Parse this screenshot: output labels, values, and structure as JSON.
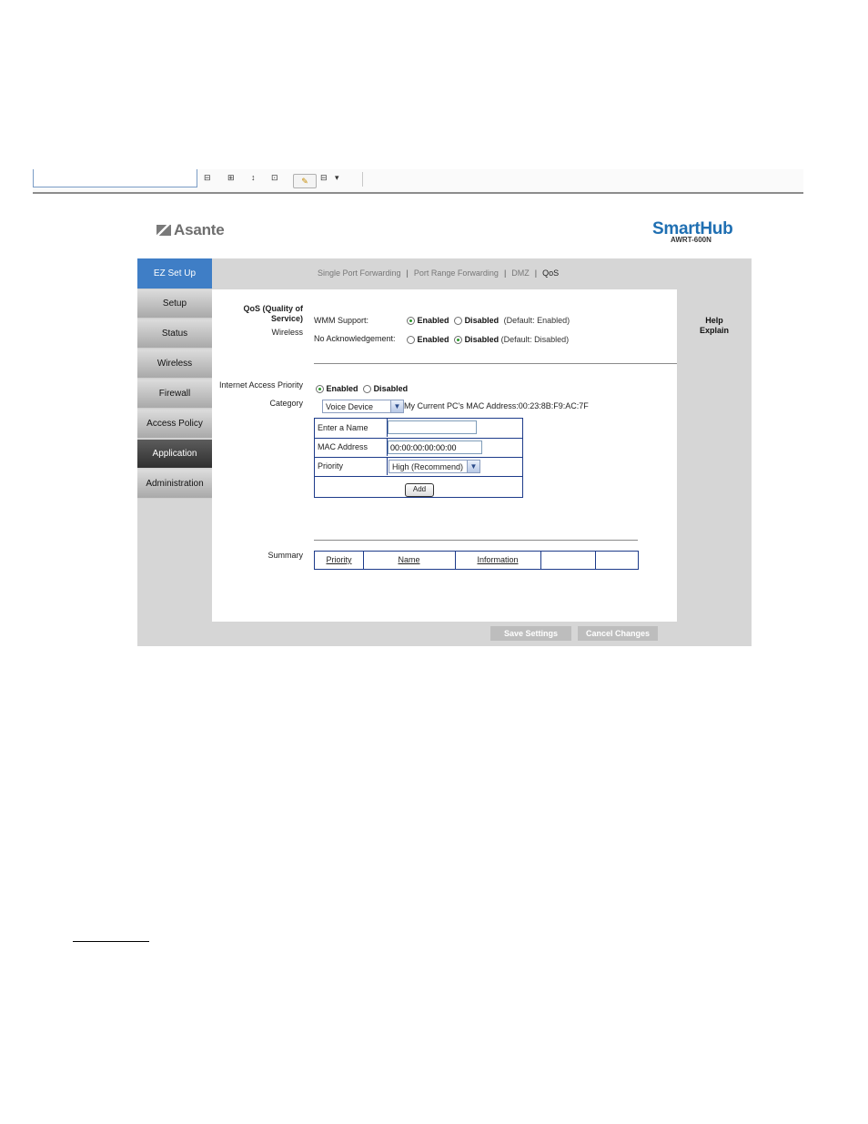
{
  "brand": {
    "left_logo": "Asante",
    "right_logo": "SmartHub",
    "model": "AWRT-600N"
  },
  "chrome": {
    "glyphs": [
      "⊟",
      "⊞",
      "↕",
      "⊡",
      "✎",
      "⊟",
      "▾"
    ]
  },
  "nav": {
    "items": [
      {
        "label": "EZ Set Up"
      },
      {
        "label": "Setup"
      },
      {
        "label": "Status"
      },
      {
        "label": "Wireless"
      },
      {
        "label": "Firewall"
      },
      {
        "label": "Access Policy"
      },
      {
        "label": "Application"
      },
      {
        "label": "Administration"
      }
    ]
  },
  "subtabs": {
    "items": [
      "Single Port Forwarding",
      "Port Range Forwarding",
      "DMZ",
      "QoS"
    ],
    "separator": "|"
  },
  "qos": {
    "section_title_line1": "QoS (Quality of",
    "section_title_line2": "Service)",
    "wireless_label": "Wireless",
    "wmm_label": "WMM Support:",
    "wmm_enabled": "Enabled",
    "wmm_disabled": "Disabled",
    "wmm_default": "(Default: Enabled)",
    "noack_label": "No Acknowledgement:",
    "noack_enabled": "Enabled",
    "noack_disabled": "Disabled",
    "noack_default": "(Default: Disabled)"
  },
  "iap": {
    "label": "Internet Access Priority",
    "enabled": "Enabled",
    "disabled": "Disabled",
    "category_label": "Category",
    "category_value": "Voice Device",
    "mac_note": "My Current PC's MAC Address:00:23:8B:F9:AC:7F"
  },
  "entry": {
    "name_label": "Enter a Name",
    "name_value": "",
    "mac_label": "MAC Address",
    "mac_value": "00:00:00:00:00:00",
    "priority_label": "Priority",
    "priority_value": "High (Recommend)",
    "add_label": "Add"
  },
  "summary": {
    "label": "Summary",
    "columns": [
      "Priority",
      "Name",
      "Information",
      "",
      ""
    ]
  },
  "help": {
    "line1": "Help",
    "line2": "Explain"
  },
  "buttons": {
    "save": "Save Settings",
    "cancel": "Cancel Changes"
  }
}
